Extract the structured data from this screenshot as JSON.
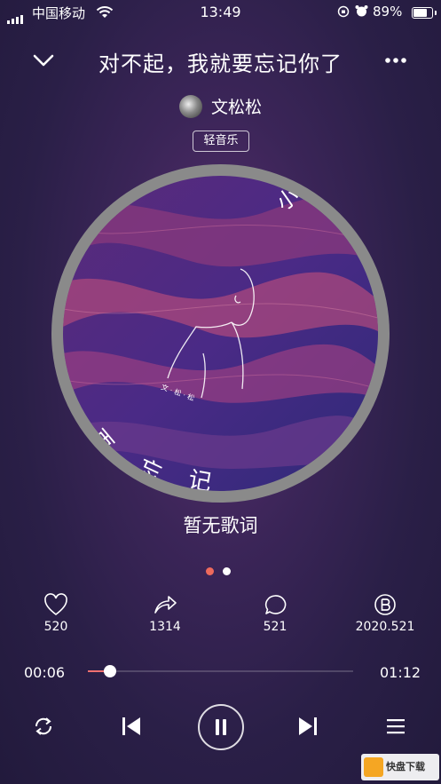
{
  "status_bar": {
    "carrier": "中国移动",
    "time": "13:49",
    "battery": "89%",
    "battery_level": 0.89
  },
  "header": {
    "title": "对不起，我就要忘记你了",
    "artist": "文松松",
    "genre_tag": "轻音乐"
  },
  "album": {
    "cover_marks": [
      "文 · 松 · 松",
      "再",
      "忘",
      "记",
      "小"
    ]
  },
  "lyrics": {
    "text": "暂无歌词"
  },
  "pager": {
    "page_count": 2,
    "active_index": 0,
    "active_color": "#ee6a5c",
    "inactive_color": "#ffffff"
  },
  "actions": {
    "like_count": "520",
    "share_count": "1314",
    "comment_count": "521",
    "extra_count": "2020.521"
  },
  "progress": {
    "elapsed": "00:06",
    "duration": "01:12",
    "fraction": 0.083,
    "accent": "#f07070"
  },
  "icons": {
    "collapse": "chevron-down-icon",
    "more": "more-dots-icon",
    "like": "heart-icon",
    "share": "share-arrow-icon",
    "comment": "comment-bubble-icon",
    "extra": "b-circle-icon",
    "repeat": "repeat-icon",
    "prev": "skip-previous-icon",
    "pause": "pause-icon",
    "next": "skip-next-icon",
    "playlist": "playlist-icon"
  },
  "watermark": {
    "text": "快盘下载"
  }
}
